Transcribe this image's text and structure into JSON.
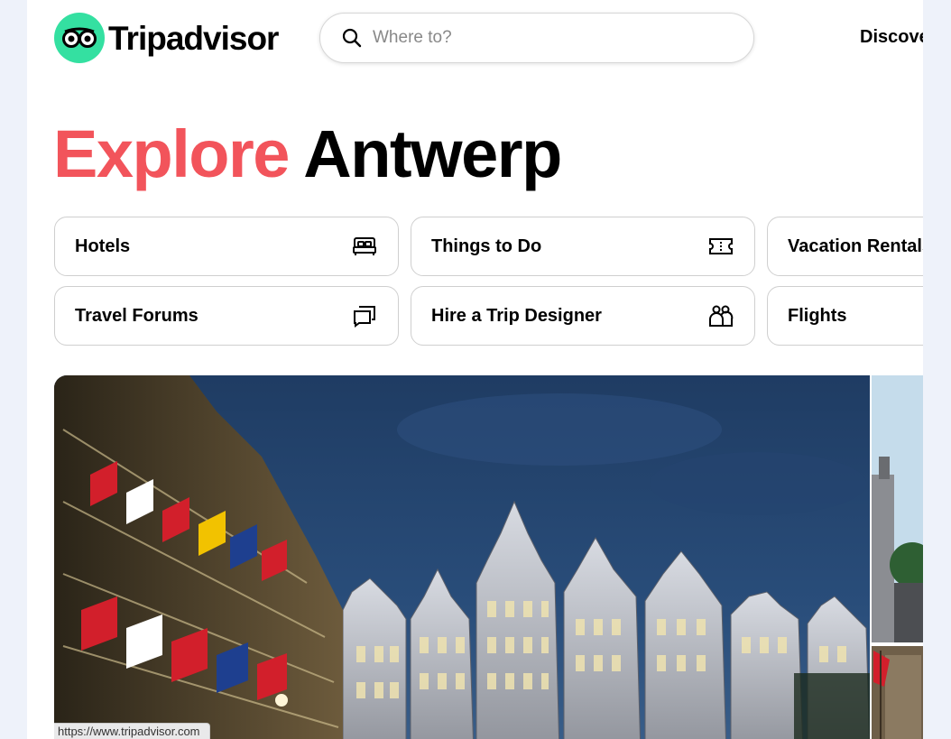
{
  "brand": {
    "name": "Tripadvisor",
    "color": "#34e0a1"
  },
  "search": {
    "placeholder": "Where to?"
  },
  "nav": {
    "discover": "Discover"
  },
  "title": {
    "accent": "Explore",
    "rest": "Antwerp",
    "accent_color": "#f2545b"
  },
  "categories": [
    {
      "label": "Hotels",
      "icon": "bed-icon"
    },
    {
      "label": "Things to Do",
      "icon": "ticket-icon"
    },
    {
      "label": "Vacation Rentals",
      "icon": "house-icon"
    },
    {
      "label": "Travel Forums",
      "icon": "chat-icon"
    },
    {
      "label": "Hire a Trip Designer",
      "icon": "people-icon"
    },
    {
      "label": "Flights",
      "icon": "plane-icon"
    }
  ],
  "status_bar": {
    "url": "https://www.tripadvisor.com"
  }
}
